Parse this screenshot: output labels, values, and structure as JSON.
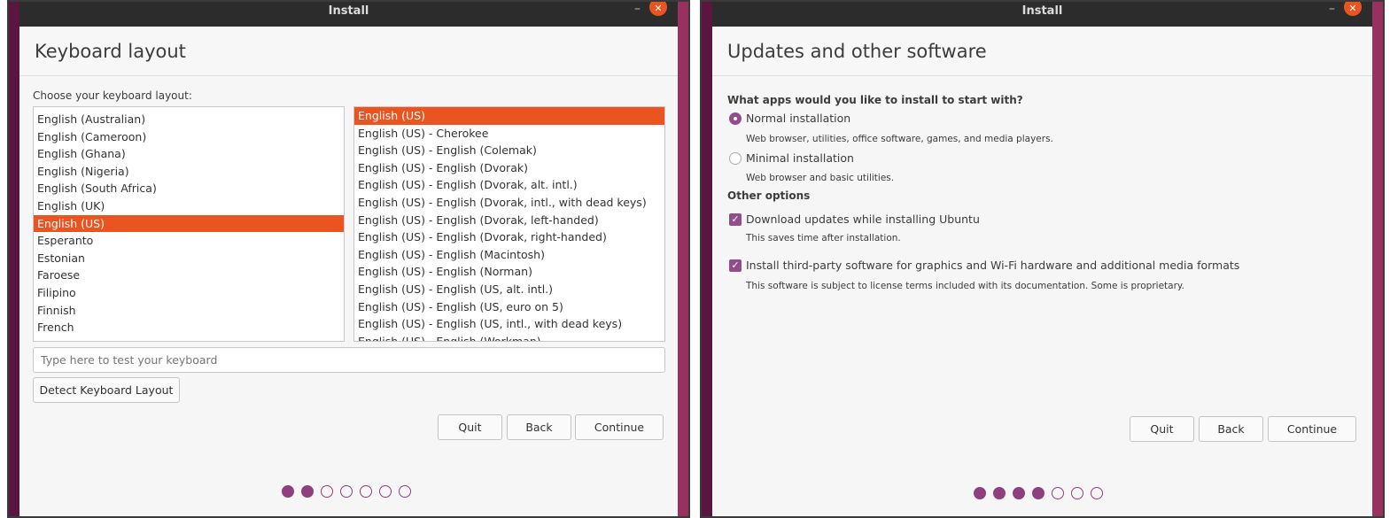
{
  "left": {
    "window_title": "Install",
    "header": "Keyboard layout",
    "choose_label": "Choose your keyboard layout:",
    "layouts": [
      {
        "label": "English (Australian)",
        "selected": false
      },
      {
        "label": "English (Cameroon)",
        "selected": false
      },
      {
        "label": "English (Ghana)",
        "selected": false
      },
      {
        "label": "English (Nigeria)",
        "selected": false
      },
      {
        "label": "English (South Africa)",
        "selected": false
      },
      {
        "label": "English (UK)",
        "selected": false
      },
      {
        "label": "English (US)",
        "selected": true
      },
      {
        "label": "Esperanto",
        "selected": false
      },
      {
        "label": "Estonian",
        "selected": false
      },
      {
        "label": "Faroese",
        "selected": false
      },
      {
        "label": "Filipino",
        "selected": false
      },
      {
        "label": "Finnish",
        "selected": false
      },
      {
        "label": "French",
        "selected": false
      }
    ],
    "variants": [
      {
        "label": "English (US)",
        "selected": true
      },
      {
        "label": "English (US) - Cherokee",
        "selected": false
      },
      {
        "label": "English (US) - English (Colemak)",
        "selected": false
      },
      {
        "label": "English (US) - English (Dvorak)",
        "selected": false
      },
      {
        "label": "English (US) - English (Dvorak, alt. intl.)",
        "selected": false
      },
      {
        "label": "English (US) - English (Dvorak, intl., with dead keys)",
        "selected": false
      },
      {
        "label": "English (US) - English (Dvorak, left-handed)",
        "selected": false
      },
      {
        "label": "English (US) - English (Dvorak, right-handed)",
        "selected": false
      },
      {
        "label": "English (US) - English (Macintosh)",
        "selected": false
      },
      {
        "label": "English (US) - English (Norman)",
        "selected": false
      },
      {
        "label": "English (US) - English (US, alt. intl.)",
        "selected": false
      },
      {
        "label": "English (US) - English (US, euro on 5)",
        "selected": false
      },
      {
        "label": "English (US) - English (US, intl., with dead keys)",
        "selected": false
      },
      {
        "label": "English (US) - English (Workman)",
        "selected": false
      }
    ],
    "test_placeholder": "Type here to test your keyboard",
    "detect_button": "Detect Keyboard Layout",
    "buttons": {
      "quit": "Quit",
      "back": "Back",
      "continue": "Continue"
    },
    "progress": {
      "total": 7,
      "done": 2
    }
  },
  "right": {
    "window_title": "Install",
    "header": "Updates and other software",
    "question": "What apps would you like to install to start with?",
    "normal": {
      "label": "Normal installation",
      "desc": "Web browser, utilities, office software, games, and media players.",
      "checked": true
    },
    "minimal": {
      "label": "Minimal installation",
      "desc": "Web browser and basic utilities.",
      "checked": false
    },
    "other_options": "Other options",
    "download_updates": {
      "label": "Download updates while installing Ubuntu",
      "desc": "This saves time after installation.",
      "checked": true
    },
    "third_party": {
      "label": "Install third-party software for graphics and Wi-Fi hardware and additional media formats",
      "desc": "This software is subject to license terms included with its documentation. Some is proprietary.",
      "checked": true
    },
    "buttons": {
      "quit": "Quit",
      "back": "Back",
      "continue": "Continue"
    },
    "progress": {
      "total": 7,
      "done": 4
    }
  },
  "colors": {
    "accent": "#e95420",
    "aubergine": "#924d8b"
  }
}
